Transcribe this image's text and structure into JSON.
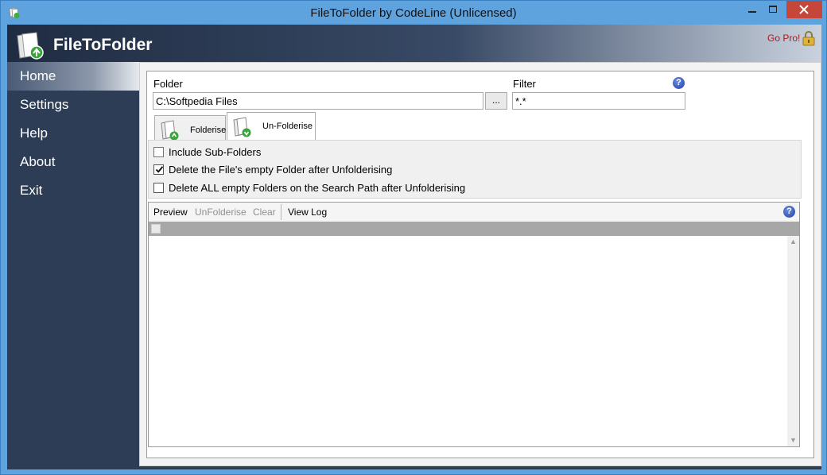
{
  "window": {
    "title": "FileToFolder by CodeLine (Unlicensed)"
  },
  "header": {
    "app_name": "FileToFolder",
    "go_pro": "Go Pro!"
  },
  "sidebar": {
    "items": [
      {
        "label": "Home",
        "active": true
      },
      {
        "label": "Settings"
      },
      {
        "label": "Help"
      },
      {
        "label": "About"
      },
      {
        "label": "Exit"
      }
    ]
  },
  "folder": {
    "label": "Folder",
    "value": "C:\\Softpedia Files",
    "browse_label": "..."
  },
  "filter": {
    "label": "Filter",
    "value": "*.*"
  },
  "tabs": [
    {
      "label": "Folderise",
      "selected": false
    },
    {
      "label": "Un-Folderise",
      "selected": true
    }
  ],
  "options": [
    {
      "label": "Include Sub-Folders",
      "checked": false
    },
    {
      "label": "Delete the File's empty Folder after Unfolderising",
      "checked": true
    },
    {
      "label": "Delete ALL empty Folders on the Search Path after Unfolderising",
      "checked": false
    }
  ],
  "toolbar": {
    "preview": "Preview",
    "unfolderise": "UnFolderise",
    "clear": "Clear",
    "view_log": "View Log"
  },
  "colors": {
    "accent_frame": "#5ea3de",
    "sidebar_bg": "#2e3d56",
    "close_button": "#c7463a",
    "go_pro_text": "#b01818"
  }
}
